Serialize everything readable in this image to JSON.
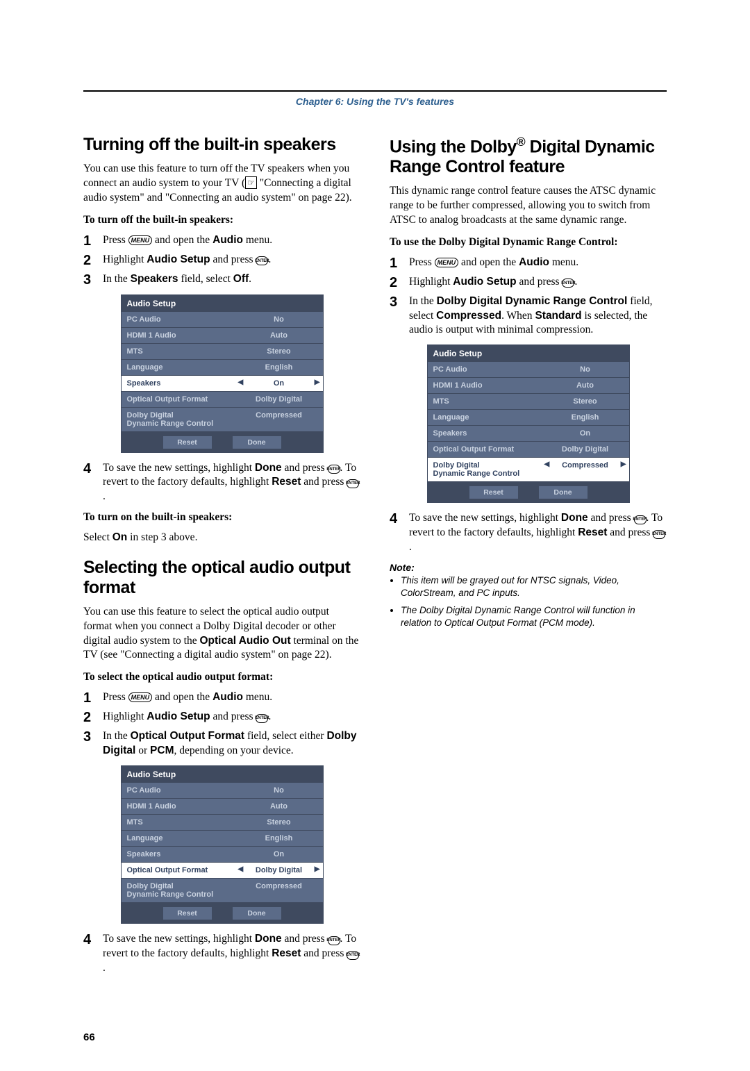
{
  "chapter_header": "Chapter 6: Using the TV's features",
  "page_number": "66",
  "left": {
    "sec1": {
      "heading": "Turning off the built-in speakers",
      "intro": "You can use this feature to turn off the TV speakers when you connect an audio system to your TV (",
      "intro2": " \"Connecting a digital audio system\" and \"Connecting an audio system\" on page 22).",
      "subhead1": "To turn off the built-in speakers:",
      "steps1": {
        "s1a": "Press ",
        "s1b": " and open the ",
        "s1c": "Audio",
        "s1d": " menu.",
        "s2a": "Highlight ",
        "s2b": "Audio Setup",
        "s2c": " and press ",
        "s3a": "In the ",
        "s3b": "Speakers",
        "s3c": " field, select ",
        "s3d": "Off",
        "s4a": "To save the new settings, highlight ",
        "s4b": "Done",
        "s4c": " and press ",
        "s4d": ". To revert to the factory defaults, highlight ",
        "s4e": "Reset",
        "s4f": " and press "
      },
      "subhead2": "To turn on the built-in speakers:",
      "line2a": "Select ",
      "line2b": "On",
      "line2c": " in step 3 above."
    },
    "sec2": {
      "heading": "Selecting the optical audio output format",
      "intro1": "You can use this feature to select the optical audio output format when you connect a Dolby Digital decoder or other digital audio system to the ",
      "intro1b": "Optical Audio Out",
      "intro1c": " terminal on the TV (see \"Connecting a digital audio system\" on page 22).",
      "subhead": "To select the optical audio output format:",
      "steps": {
        "s1a": "Press ",
        "s1b": " and open the ",
        "s1c": "Audio",
        "s1d": " menu.",
        "s2a": "Highlight ",
        "s2b": "Audio Setup",
        "s2c": " and press ",
        "s3a": "In the ",
        "s3b": "Optical Output Format",
        "s3c": " field, select either ",
        "s3d": "Dolby Digital",
        "s3e": " or ",
        "s3f": "PCM",
        "s3g": ", depending on your device.",
        "s4a": "To save the new settings, highlight ",
        "s4b": "Done",
        "s4c": " and press ",
        "s4d": ". To revert to the factory defaults, highlight ",
        "s4e": "Reset",
        "s4f": " and press "
      }
    }
  },
  "right": {
    "sec1": {
      "heading_a": "Using the Dolby",
      "heading_b": " Digital Dynamic Range Control feature",
      "intro": "This dynamic range control feature causes the ATSC dynamic range to be further compressed, allowing you to switch from ATSC to analog broadcasts at the same dynamic range.",
      "subhead": "To use the Dolby Digital Dynamic Range Control:",
      "steps": {
        "s1a": "Press ",
        "s1b": " and open the ",
        "s1c": "Audio",
        "s1d": " menu.",
        "s2a": "Highlight ",
        "s2b": "Audio Setup",
        "s2c": " and press ",
        "s3a": "In the ",
        "s3b": "Dolby Digital Dynamic Range Control",
        "s3c": " field, select ",
        "s3d": "Compressed",
        "s3e": ". When ",
        "s3f": "Standard",
        "s3g": " is selected, the audio is output with minimal compression.",
        "s4a": "To save the new settings, highlight ",
        "s4b": "Done",
        "s4c": " and press ",
        "s4d": ". To revert to the factory defaults, highlight ",
        "s4e": "Reset",
        "s4f": " and press "
      },
      "note_head": "Note:",
      "note1": "This item will be grayed out for NTSC signals, Video, ColorStream, and PC inputs.",
      "note2": "The Dolby Digital Dynamic Range Control will function in relation to Optical Output Format (PCM mode)."
    }
  },
  "panel": {
    "title": "Audio Setup",
    "labels": {
      "pc_audio": "PC Audio",
      "hdmi1": "HDMI 1 Audio",
      "mts": "MTS",
      "language": "Language",
      "speakers": "Speakers",
      "optical": "Optical Output Format",
      "dolby_l1": "Dolby Digital",
      "dolby_l2": "Dynamic Range Control"
    },
    "values": {
      "pc_audio": "No",
      "hdmi1": "Auto",
      "mts": "Stereo",
      "language": "English",
      "speakers": "On",
      "optical": "Dolby Digital",
      "dolby": "Compressed"
    },
    "reset": "Reset",
    "done": "Done"
  },
  "glyphs": {
    "menu": "MENU",
    "enter": "ENTER"
  }
}
